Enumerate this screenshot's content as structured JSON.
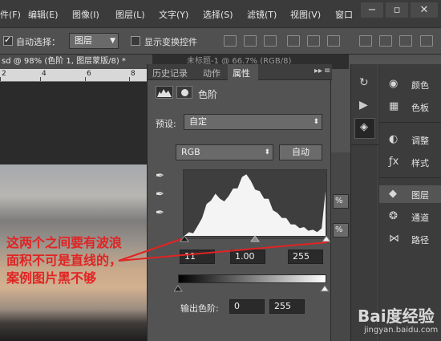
{
  "menu": {
    "items": [
      "件(F)",
      "编辑(E)",
      "图像(I)",
      "图层(L)",
      "文字(Y)",
      "选择(S)",
      "滤镜(T)",
      "视图(V)",
      "窗口"
    ]
  },
  "options": {
    "auto_select_label": "自动选择：",
    "auto_select_value": "图层",
    "show_transform_label": "显示变换控件"
  },
  "doc_tabs": {
    "active": "sd @ 98% (色阶 1, 图层蒙版/8) *",
    "inactive": "未标题-1 @ 66.7% (RGB/8)"
  },
  "ruler": {
    "labels": [
      "2",
      "4",
      "6",
      "8"
    ]
  },
  "properties": {
    "tabs": [
      "历史记录",
      "动作",
      "属性"
    ],
    "title": "色阶",
    "preset_label": "预设:",
    "preset_value": "自定",
    "channel_value": "RGB",
    "auto_button": "自动",
    "input_black": "11",
    "input_gamma": "1.00",
    "input_white": "255",
    "output_label": "输出色阶:",
    "output_black": "0",
    "output_white": "255"
  },
  "mid_panel": {
    "values": [
      "%",
      "%"
    ]
  },
  "dock": {
    "items": [
      {
        "icon": "palette-icon",
        "label": "颜色"
      },
      {
        "icon": "swatches-icon",
        "label": "色板"
      },
      {
        "icon": "adjustments-icon",
        "label": "调整"
      },
      {
        "icon": "styles-icon",
        "label": "样式"
      },
      {
        "icon": "layers-icon",
        "label": "图层"
      },
      {
        "icon": "channels-icon",
        "label": "通道"
      },
      {
        "icon": "paths-icon",
        "label": "路径"
      }
    ]
  },
  "annotation": {
    "text": "这两个之间要有波浪面积不可是直线的，案例图片黑不够"
  },
  "watermark": {
    "brand": "Bai度经验",
    "url": "jingyan.baidu.com"
  },
  "chart_data": {
    "type": "area",
    "description_values": [],
    "x": [
      0,
      8,
      16,
      24,
      32,
      40,
      48,
      56,
      64,
      72,
      80,
      88,
      96,
      104,
      112,
      120,
      128,
      136,
      144,
      152,
      160,
      168,
      176,
      184,
      192,
      200,
      208,
      216,
      224,
      232,
      240,
      248,
      255
    ],
    "values": [
      0,
      2,
      4,
      12,
      28,
      46,
      55,
      62,
      58,
      50,
      62,
      70,
      74,
      88,
      96,
      82,
      72,
      66,
      58,
      54,
      40,
      32,
      28,
      24,
      18,
      14,
      12,
      10,
      8,
      6,
      6,
      8,
      70
    ],
    "xlim": [
      0,
      255
    ],
    "ylim": [
      0,
      100
    ]
  },
  "colors": {
    "annotation": "#e02424",
    "panel_bg": "#535353",
    "menubar_bg": "#3b3b3b"
  }
}
